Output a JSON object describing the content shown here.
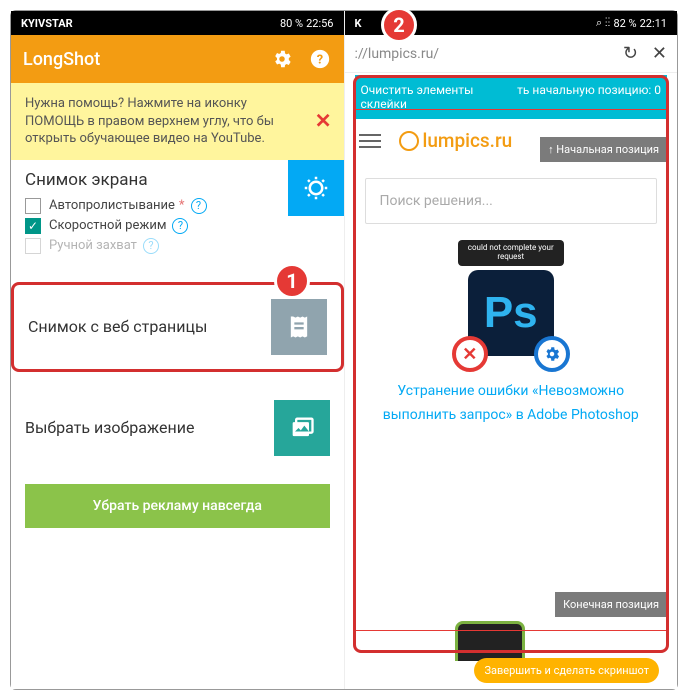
{
  "left": {
    "status": {
      "carrier": "KYIVSTAR",
      "net": "80 %",
      "time": "22:56",
      "icons": "✽ ⋮⋮ 🗨"
    },
    "appbar": {
      "title": "LongShot"
    },
    "banner": {
      "text": "Нужна помощь? Нажмите на иконку ПОМОЩЬ в правом верхнем углу, что бы открыть обучающее видео на YouTube."
    },
    "screenshot": {
      "title": "Снимок экрана",
      "opt_autoscroll": "Автопролистывание",
      "opt_speed": "Скоростной режим",
      "opt_manual": "Ручной захват"
    },
    "websnap": {
      "label": "Снимок с веб страницы"
    },
    "pickimg": {
      "label": "Выбрать изображение"
    },
    "removeads": {
      "label": "Убрать рекламу навсегда"
    },
    "badge1": "1"
  },
  "right": {
    "status": {
      "carrier": "K",
      "net": "82 %",
      "time": "22:11"
    },
    "url": "://lumpics.ru/",
    "tealbar": {
      "clear": "Очистить элементы склейки",
      "reset": "ть начальную позицию: 0"
    },
    "logo": "lumpics.ru",
    "startpos": "↑ Начальная позиция",
    "endpos": "Конечная позиция",
    "search_ph": "Поиск решения...",
    "ps_top": "could not complete your request",
    "ps": "Ps",
    "article": "Устранение ошибки «Невозможно выполнить запрос» в Adobe Photoshop",
    "bottompill": "Завершить и сделать скриншот",
    "badge2": "2"
  }
}
